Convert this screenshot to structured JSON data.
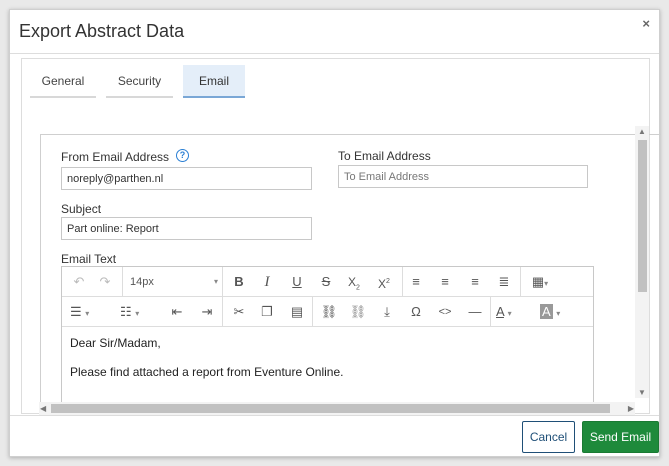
{
  "dialog": {
    "title": "Export Abstract Data",
    "close_glyph": "×"
  },
  "tabs": [
    {
      "label": "General",
      "active": false
    },
    {
      "label": "Security",
      "active": false
    },
    {
      "label": "Email",
      "active": true
    }
  ],
  "form": {
    "from_label": "From Email Address",
    "from_value": "noreply@parthen.nl",
    "help_glyph": "?",
    "to_label": "To Email Address",
    "to_value": "",
    "to_placeholder": "To Email Address",
    "subject_label": "Subject",
    "subject_value": "Part online: Report",
    "email_text_label": "Email Text"
  },
  "editor": {
    "font_size": "14px",
    "toolbar_row1": [
      "undo",
      "redo",
      "font-size",
      "bold",
      "italic",
      "underline",
      "strikethrough",
      "subscript",
      "superscript",
      "align-left",
      "align-center",
      "align-right",
      "justify",
      "table"
    ],
    "toolbar_row2": [
      "bullet-list",
      "numbered-list",
      "outdent",
      "indent",
      "cut",
      "copy",
      "paste",
      "link",
      "unlink",
      "insert-file",
      "special-character",
      "source-code",
      "horizontal-rule",
      "font-color",
      "highlight-color"
    ],
    "body_lines": [
      "Dear Sir/Madam,",
      "Please find attached a report from Eventure Online."
    ]
  },
  "footer": {
    "cancel_label": "Cancel",
    "send_label": "Send Email"
  },
  "colors": {
    "primary_action": "#1e8a3b",
    "cancel_border": "#1f4f77",
    "help_icon": "#2a7fd4",
    "active_tab_bg": "#e4eef9"
  }
}
